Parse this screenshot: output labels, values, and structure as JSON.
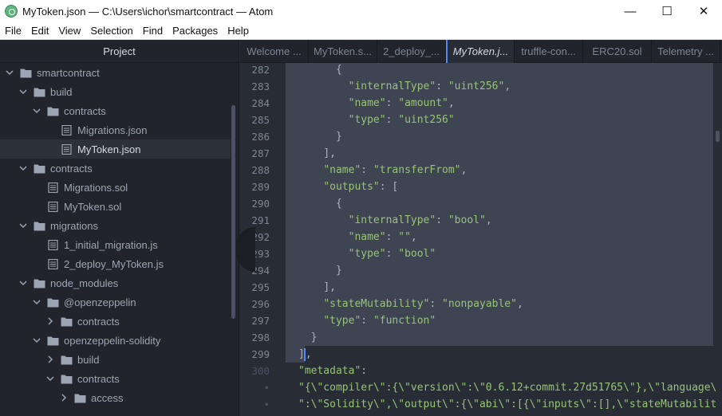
{
  "window": {
    "title": "MyToken.json — C:\\Users\\ichor\\smartcontract — Atom",
    "minimize": "—",
    "maximize": "☐",
    "close": "✕"
  },
  "menu": [
    "File",
    "Edit",
    "View",
    "Selection",
    "Find",
    "Packages",
    "Help"
  ],
  "sidebar": {
    "header": "Project",
    "tree": [
      {
        "label": "smartcontract",
        "type": "folder",
        "depth": 0,
        "expanded": true
      },
      {
        "label": "build",
        "type": "folder",
        "depth": 1,
        "expanded": true
      },
      {
        "label": "contracts",
        "type": "folder",
        "depth": 2,
        "expanded": true
      },
      {
        "label": "Migrations.json",
        "type": "file",
        "depth": 3
      },
      {
        "label": "MyToken.json",
        "type": "file",
        "depth": 3,
        "selected": true
      },
      {
        "label": "contracts",
        "type": "folder",
        "depth": 1,
        "expanded": true
      },
      {
        "label": "Migrations.sol",
        "type": "file",
        "depth": 2
      },
      {
        "label": "MyToken.sol",
        "type": "file",
        "depth": 2
      },
      {
        "label": "migrations",
        "type": "folder",
        "depth": 1,
        "expanded": true
      },
      {
        "label": "1_initial_migration.js",
        "type": "file",
        "depth": 2
      },
      {
        "label": "2_deploy_MyToken.js",
        "type": "file",
        "depth": 2
      },
      {
        "label": "node_modules",
        "type": "folder",
        "depth": 1,
        "expanded": true
      },
      {
        "label": "@openzeppelin",
        "type": "folder",
        "depth": 2,
        "expanded": true
      },
      {
        "label": "contracts",
        "type": "folder",
        "depth": 3,
        "expanded": false
      },
      {
        "label": "openzeppelin-solidity",
        "type": "folder",
        "depth": 2,
        "expanded": true
      },
      {
        "label": "build",
        "type": "folder",
        "depth": 3,
        "expanded": false
      },
      {
        "label": "contracts",
        "type": "folder",
        "depth": 3,
        "expanded": true
      },
      {
        "label": "access",
        "type": "folder",
        "depth": 4,
        "expanded": false
      }
    ]
  },
  "tabs": [
    {
      "label": "Welcome ...",
      "active": false
    },
    {
      "label": "MyToken.s...",
      "active": false
    },
    {
      "label": "2_deploy_...",
      "active": false
    },
    {
      "label": "MyToken.j...",
      "active": true
    },
    {
      "label": "truffle-con...",
      "active": false
    },
    {
      "label": "ERC20.sol",
      "active": false
    },
    {
      "label": "Telemetry ...",
      "active": false
    }
  ],
  "editor": {
    "lines": [
      {
        "num": "282",
        "text": "      {",
        "sel": true
      },
      {
        "num": "283",
        "text": "        \"internalType\": \"uint256\",",
        "sel": true
      },
      {
        "num": "284",
        "text": "        \"name\": \"amount\",",
        "sel": true
      },
      {
        "num": "285",
        "text": "        \"type\": \"uint256\"",
        "sel": true
      },
      {
        "num": "286",
        "text": "      }",
        "sel": true
      },
      {
        "num": "287",
        "text": "    ],",
        "sel": true
      },
      {
        "num": "288",
        "text": "    \"name\": \"transferFrom\",",
        "sel": true
      },
      {
        "num": "289",
        "text": "    \"outputs\": [",
        "sel": true
      },
      {
        "num": "290",
        "text": "      {",
        "sel": true
      },
      {
        "num": "291",
        "text": "        \"internalType\": \"bool\",",
        "sel": true
      },
      {
        "num": "292",
        "text": "        \"name\": \"\",",
        "sel": true
      },
      {
        "num": "293",
        "text": "        \"type\": \"bool\"",
        "sel": true
      },
      {
        "num": "294",
        "text": "      }",
        "sel": true
      },
      {
        "num": "295",
        "text": "    ],",
        "sel": true
      },
      {
        "num": "296",
        "text": "    \"stateMutability\": \"nonpayable\",",
        "sel": true
      },
      {
        "num": "297",
        "text": "    \"type\": \"function\"",
        "sel": true
      },
      {
        "num": "298",
        "text": "  }",
        "sel": true
      },
      {
        "num": "299",
        "text": "],",
        "sel": "partial"
      },
      {
        "num": "300",
        "text": "\"metadata\":",
        "sel": false,
        "dim": true
      },
      {
        "num": "•",
        "text": "\"{\\\"compiler\\\":{\\\"version\\\":\\\"0.6.12+commit.27d51765\\\"},\\\"language\\",
        "sel": false,
        "dim": true
      },
      {
        "num": "•",
        "text": "\":\\\"Solidity\\\",\\\"output\\\":{\\\"abi\\\":[{\\\"inputs\\\":[],\\\"stateMutabilit",
        "sel": false,
        "dim": true
      }
    ]
  }
}
